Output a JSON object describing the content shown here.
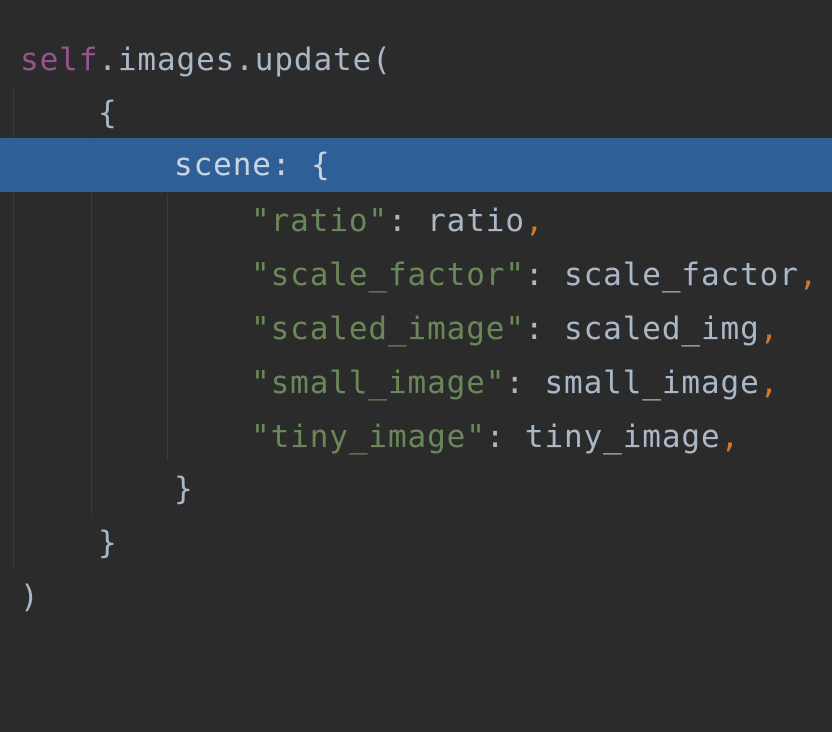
{
  "editor": {
    "language": "python",
    "highlighted_line": 3,
    "colors": {
      "background": "#2b2b2b",
      "selection": "#2f5f97",
      "keyword_self": "#94558d",
      "string": "#6a8759",
      "comma": "#cc7832",
      "default_text": "#a9b7c6"
    },
    "lines": {
      "l1": {
        "self": "self",
        "rest": ".images.update("
      },
      "l2": {
        "text": "{"
      },
      "l3": {
        "text": "scene: {"
      },
      "l4": {
        "key": "\"ratio\"",
        "colon": ": ",
        "value": "ratio",
        "comma": ","
      },
      "l5": {
        "key": "\"scale_factor\"",
        "colon": ": ",
        "value": "scale_factor",
        "comma": ","
      },
      "l6": {
        "key": "\"scaled_image\"",
        "colon": ": ",
        "value": "scaled_img",
        "comma": ","
      },
      "l7": {
        "key": "\"small_image\"",
        "colon": ": ",
        "value": "small_image",
        "comma": ","
      },
      "l8": {
        "key": "\"tiny_image\"",
        "colon": ": ",
        "value": "tiny_image",
        "comma": ","
      },
      "l9": {
        "text": "}"
      },
      "l10": {
        "text": "}"
      },
      "l11": {
        "text": ")"
      }
    }
  }
}
